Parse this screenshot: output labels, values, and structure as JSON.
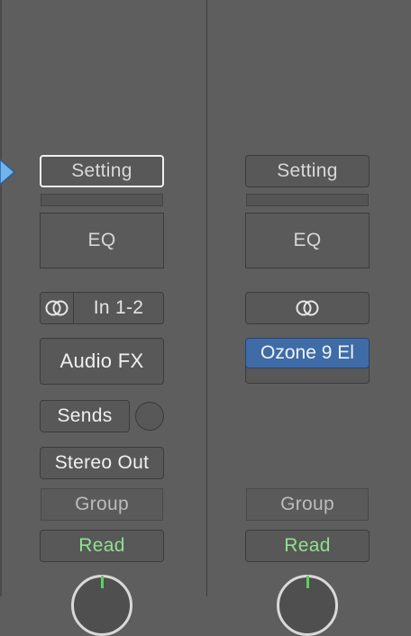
{
  "channel_left": {
    "setting_label": "Setting",
    "eq_label": "EQ",
    "link_icon": "stereo-link-icon",
    "input_label": "In 1-2",
    "audio_fx_label": "Audio FX",
    "sends_label": "Sends",
    "output_label": "Stereo Out",
    "group_label": "Group",
    "automation_label": "Read"
  },
  "channel_right": {
    "setting_label": "Setting",
    "eq_label": "EQ",
    "link_icon": "stereo-link-icon",
    "plugin_label": "Ozone 9 El",
    "group_label": "Group",
    "automation_label": "Read"
  },
  "colors": {
    "background": "#5e5e5e",
    "plugin_blue": "#3f6ca6",
    "read_green": "#8fe08f",
    "selection_arrow": "#6fb4f0"
  }
}
